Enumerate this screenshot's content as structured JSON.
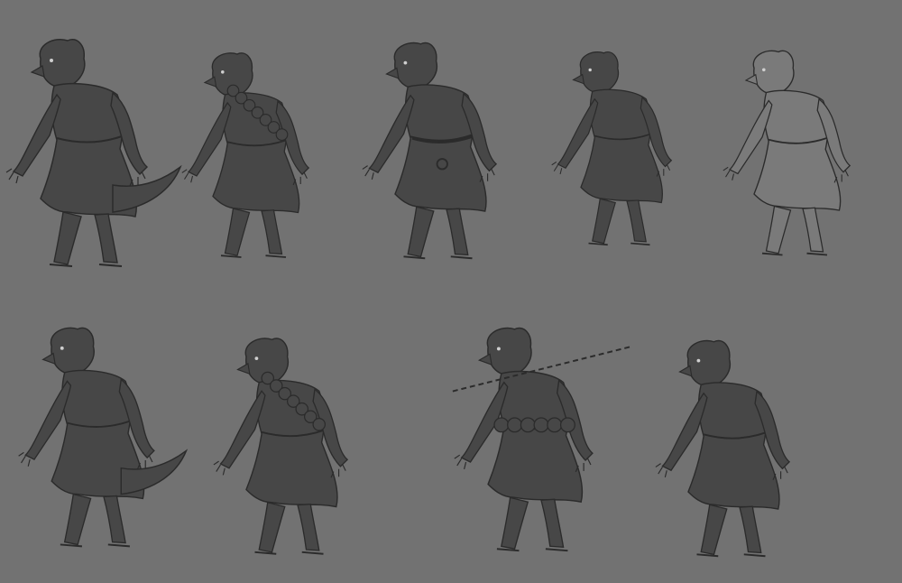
{
  "sheet": {
    "background": "#727272",
    "ink": "#2b2b2b",
    "silhouette": "#474747",
    "silhouette_light": "#7a7a7a",
    "figures": [
      {
        "id": 1,
        "rendering": "dark",
        "accessory": "tail"
      },
      {
        "id": 2,
        "rendering": "dark",
        "accessory": "prayer-beads"
      },
      {
        "id": 3,
        "rendering": "dark",
        "accessory": "rope-belt"
      },
      {
        "id": 4,
        "rendering": "dark",
        "accessory": "bare-chest"
      },
      {
        "id": 5,
        "rendering": "light",
        "accessory": "robe"
      },
      {
        "id": 6,
        "rendering": "dark",
        "accessory": "tail"
      },
      {
        "id": 7,
        "rendering": "dark",
        "accessory": "prayer-beads"
      },
      {
        "id": 8,
        "rendering": "dark",
        "accessory": "staff"
      },
      {
        "id": 9,
        "rendering": "dark",
        "accessory": "robe"
      }
    ]
  }
}
